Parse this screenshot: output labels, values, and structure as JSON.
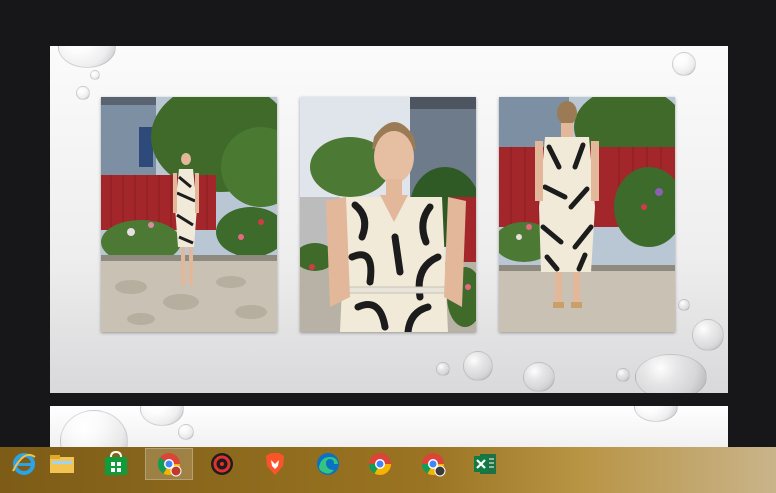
{
  "slideshow": {
    "slide1_photos": [
      {
        "name": "photo-full-body-front"
      },
      {
        "name": "photo-portrait-front"
      },
      {
        "name": "photo-full-body-back"
      }
    ]
  },
  "taskbar": {
    "buttons": [
      {
        "name": "internet-explorer-icon",
        "active": false
      },
      {
        "name": "file-explorer-icon",
        "active": false
      },
      {
        "name": "store-icon",
        "active": false
      },
      {
        "name": "chrome-icon",
        "active": true
      },
      {
        "name": "app-red-icon",
        "active": false
      },
      {
        "name": "brave-icon",
        "active": false
      },
      {
        "name": "edge-icon",
        "active": false
      },
      {
        "name": "chrome-icon-2",
        "active": false
      },
      {
        "name": "chrome-icon-3",
        "active": false
      },
      {
        "name": "excel-icon",
        "active": false
      }
    ]
  },
  "colors": {
    "taskbar_gold": "#9a7422",
    "fence_red": "#a3262b",
    "foliage_green": "#3f6a2a"
  }
}
